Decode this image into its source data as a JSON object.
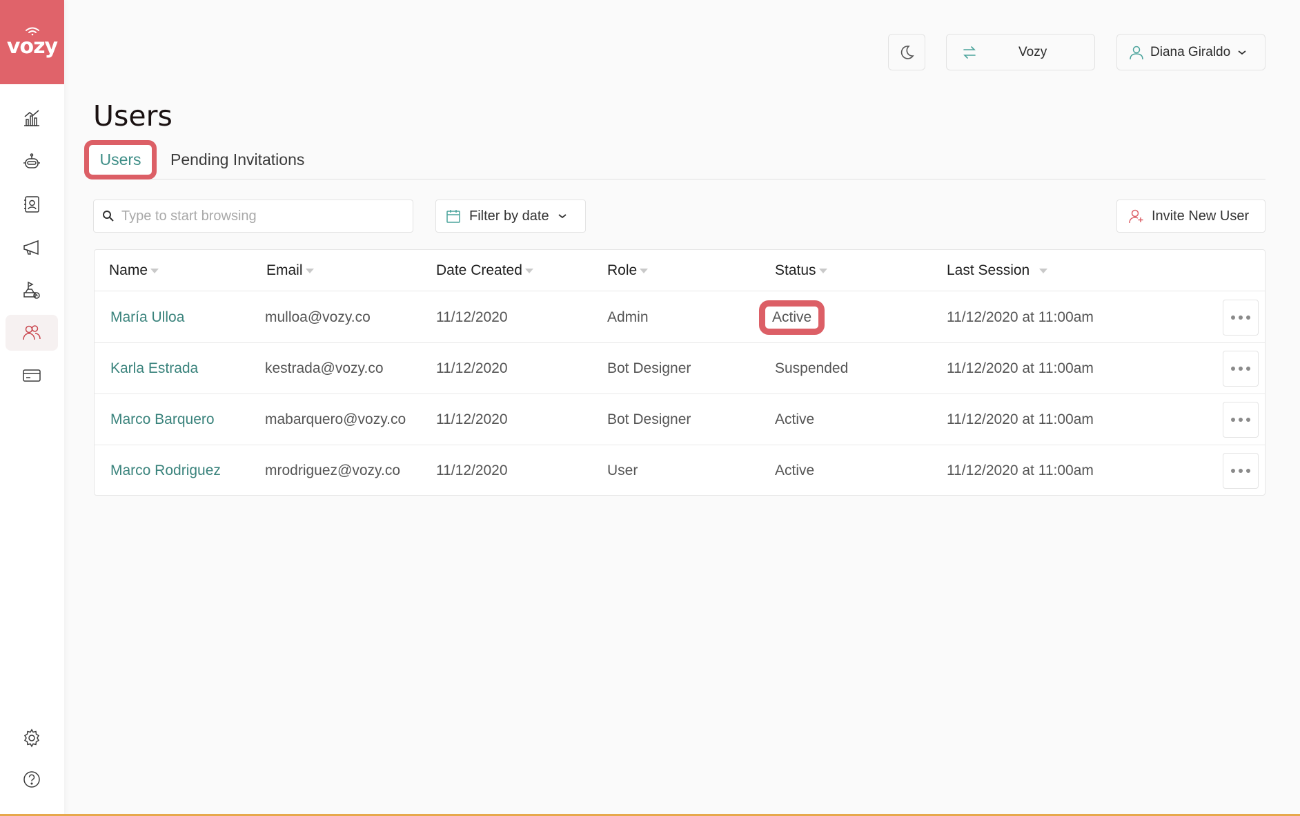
{
  "brand": {
    "logo_text": "vozy",
    "accent_color": "#e0636a",
    "link_color": "#3a837c"
  },
  "sidebar": {
    "items": [
      {
        "icon": "analytics-icon"
      },
      {
        "icon": "bot-icon"
      },
      {
        "icon": "contacts-icon"
      },
      {
        "icon": "campaign-icon"
      },
      {
        "icon": "scheduled-calls-icon"
      },
      {
        "icon": "users-icon",
        "active": true
      },
      {
        "icon": "billing-icon"
      }
    ],
    "bottom": [
      {
        "icon": "gear-icon"
      },
      {
        "icon": "help-icon"
      }
    ]
  },
  "header": {
    "theme_icon": "moon-icon",
    "org_switch_icon": "swap-icon",
    "org_name": "Vozy",
    "user_icon": "user-icon",
    "user_name": "Diana Giraldo"
  },
  "page": {
    "title": "Users",
    "tabs": [
      {
        "label": "Users",
        "active": true
      },
      {
        "label": "Pending Invitations"
      }
    ]
  },
  "controls": {
    "search_placeholder": "Type to start browsing",
    "filter_label": "Filter by date",
    "invite_label": "Invite New User"
  },
  "table": {
    "columns": [
      "Name",
      "Email",
      "Date Created",
      "Role",
      "Status",
      "Last Session"
    ],
    "rows": [
      {
        "name": "María Ulloa",
        "email": "mulloa@vozy.co",
        "date": "11/12/2020",
        "role": "Admin",
        "status": "Active",
        "last": "11/12/2020 at 11:00am"
      },
      {
        "name": "Karla Estrada",
        "email": "kestrada@vozy.co",
        "date": "11/12/2020",
        "role": "Bot Designer",
        "status": "Suspended",
        "last": "11/12/2020 at 11:00am"
      },
      {
        "name": "Marco Barquero",
        "email": "mabarquero@vozy.co",
        "date": "11/12/2020",
        "role": "Bot Designer",
        "status": "Active",
        "last": "11/12/2020 at 11:00am"
      },
      {
        "name": "Marco Rodriguez",
        "email": "mrodriguez@vozy.co",
        "date": "11/12/2020",
        "role": "User",
        "status": "Active",
        "last": "11/12/2020 at 11:00am"
      }
    ]
  }
}
